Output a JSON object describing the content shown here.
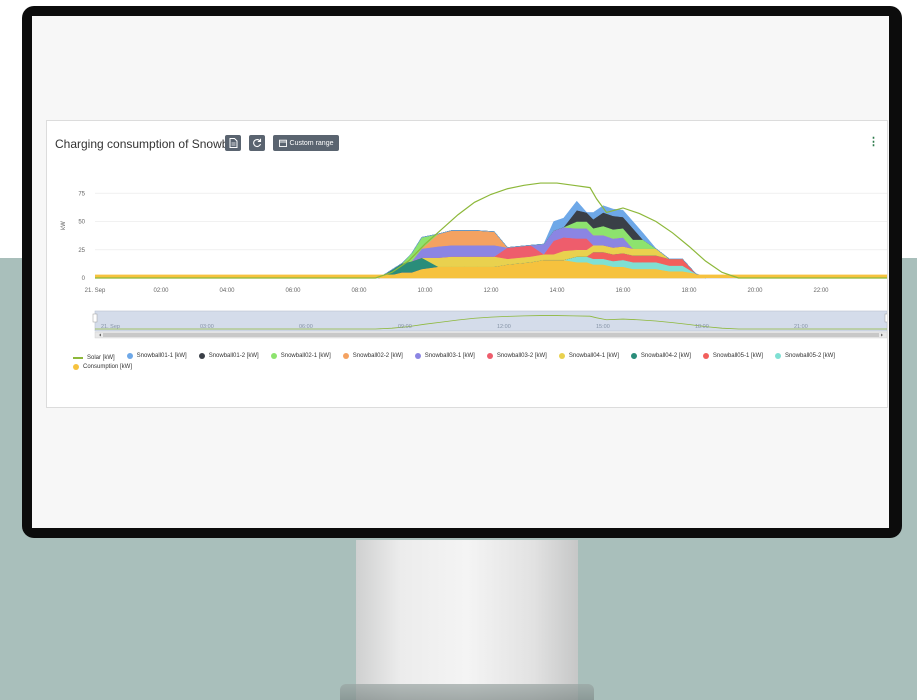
{
  "colors": {
    "solar": "#8db83a",
    "snowball01_1": "#6ea8e8",
    "snowball01_2": "#3a3f47",
    "snowball02_1": "#8de36e",
    "snowball02_2": "#f4a261",
    "snowball03_1": "#8b85e3",
    "snowball03_2": "#ee5d6c",
    "snowball04_1": "#e9d14e",
    "snowball04_2": "#2a8d7a",
    "snowball05_1": "#f25f5c",
    "snowball05_2": "#7fe0d3",
    "consumption": "#f6c23e"
  },
  "card": {
    "title": "Charging consumption of Snowball",
    "export_icon": "file-icon",
    "refresh_icon": "refresh-icon",
    "custom_range_label": "Custom range",
    "calendar_icon": "calendar-icon",
    "menu_icon": "kebab-menu-icon"
  },
  "chart_data": {
    "type": "area",
    "ylabel": "kW",
    "y_ticks": [
      "75",
      "50",
      "25",
      "0"
    ],
    "ylim": [
      0,
      100
    ],
    "x_ticks": [
      "21. Sep",
      "02:00",
      "04:00",
      "06:00",
      "08:00",
      "10:00",
      "12:00",
      "14:00",
      "16:00",
      "18:00",
      "20:00",
      "22:00"
    ],
    "x_hours": [
      0,
      2,
      4,
      6,
      8,
      10,
      12,
      14,
      16,
      18,
      20,
      22
    ],
    "xlim": [
      0,
      24
    ],
    "grid": true,
    "legend_position": "bottom",
    "navigator_ticks": [
      "21. Sep",
      "03:00",
      "06:00",
      "09:00",
      "12:00",
      "15:00",
      "18:00",
      "21:00"
    ],
    "solar": {
      "name": "Solar [kW]",
      "points": [
        [
          0,
          0
        ],
        [
          8.5,
          0
        ],
        [
          9,
          5
        ],
        [
          9.5,
          15
        ],
        [
          10,
          30
        ],
        [
          10.5,
          43
        ],
        [
          11,
          56
        ],
        [
          11.5,
          67
        ],
        [
          12,
          74
        ],
        [
          12.5,
          79
        ],
        [
          13,
          82
        ],
        [
          13.5,
          84
        ],
        [
          14,
          84
        ],
        [
          14.5,
          82
        ],
        [
          15,
          80
        ],
        [
          15.2,
          70
        ],
        [
          15.5,
          58
        ],
        [
          16,
          62
        ],
        [
          16.5,
          57
        ],
        [
          17,
          50
        ],
        [
          17.5,
          40
        ],
        [
          18,
          28
        ],
        [
          18.5,
          15
        ],
        [
          19,
          5
        ],
        [
          19.5,
          0
        ],
        [
          24,
          0
        ]
      ]
    },
    "x": [
      8.6,
      9.3,
      9.6,
      9.9,
      10.4,
      10.8,
      11.2,
      11.6,
      12.1,
      12.5,
      13.2,
      13.6,
      13.9,
      14.2,
      14.6,
      14.9,
      15.1,
      15.4,
      15.7,
      16.0,
      16.3,
      16.6,
      17.0,
      17.4,
      17.8,
      18.2,
      18.5
    ],
    "series": [
      {
        "name": "Consumption [kW]",
        "key": "consumption",
        "values": [
          0,
          5,
          5,
          8,
          10,
          10,
          10,
          10,
          10,
          12,
          14,
          16,
          16,
          16,
          14,
          14,
          12,
          12,
          10,
          10,
          8,
          8,
          8,
          6,
          6,
          4,
          0
        ]
      },
      {
        "name": "Snowball05-2 [kW]",
        "key": "snowball05_2",
        "values": [
          0,
          0,
          0,
          0,
          0,
          0,
          0,
          0,
          0,
          0,
          0,
          0,
          0,
          0,
          5,
          5,
          5,
          5,
          5,
          6,
          6,
          6,
          6,
          5,
          5,
          0,
          0
        ]
      },
      {
        "name": "Snowball05-1 [kW]",
        "key": "snowball05_1",
        "values": [
          0,
          0,
          0,
          0,
          0,
          0,
          0,
          0,
          0,
          0,
          0,
          0,
          0,
          0,
          0,
          0,
          6,
          6,
          6,
          6,
          6,
          6,
          6,
          6,
          6,
          0,
          0
        ]
      },
      {
        "name": "Snowball04-2 [kW]",
        "key": "snowball04_2",
        "values": [
          0,
          8,
          10,
          10,
          0,
          0,
          0,
          0,
          0,
          0,
          0,
          0,
          0,
          0,
          0,
          0,
          0,
          0,
          0,
          0,
          0,
          0,
          0,
          0,
          0,
          0,
          0
        ]
      },
      {
        "name": "Snowball04-1 [kW]",
        "key": "snowball04_1",
        "values": [
          0,
          0,
          0,
          0,
          8,
          9,
          9,
          9,
          9,
          5,
          5,
          5,
          5,
          8,
          6,
          6,
          6,
          6,
          6,
          6,
          6,
          6,
          6,
          0,
          0,
          0,
          0
        ]
      },
      {
        "name": "Snowball03-2 [kW]",
        "key": "snowball03_2",
        "values": [
          0,
          0,
          0,
          0,
          0,
          0,
          0,
          0,
          0,
          10,
          10,
          0,
          12,
          12,
          10,
          10,
          0,
          0,
          0,
          0,
          0,
          0,
          0,
          0,
          0,
          0,
          0
        ]
      },
      {
        "name": "Snowball03-1 [kW]",
        "key": "snowball03_1",
        "values": [
          0,
          0,
          0,
          8,
          10,
          10,
          10,
          10,
          10,
          0,
          0,
          9,
          9,
          9,
          9,
          9,
          9,
          9,
          8,
          8,
          0,
          0,
          0,
          0,
          0,
          0,
          0
        ]
      },
      {
        "name": "Snowball02-2 [kW]",
        "key": "snowball02_2",
        "values": [
          0,
          0,
          0,
          0,
          11,
          13,
          13,
          13,
          12,
          0,
          0,
          0,
          0,
          0,
          0,
          0,
          0,
          0,
          0,
          0,
          0,
          0,
          0,
          0,
          0,
          0,
          0
        ]
      },
      {
        "name": "Snowball02-1 [kW]",
        "key": "snowball02_1",
        "values": [
          0,
          0,
          7,
          10,
          0,
          0,
          0,
          0,
          0,
          0,
          0,
          0,
          0,
          0,
          6,
          6,
          6,
          8,
          8,
          8,
          8,
          8,
          0,
          0,
          0,
          0,
          0
        ]
      },
      {
        "name": "Snowball01-2 [kW]",
        "key": "snowball01_2",
        "values": [
          0,
          0,
          0,
          0,
          0,
          0,
          0,
          0,
          0,
          0,
          0,
          0,
          0,
          0,
          10,
          8,
          8,
          12,
          12,
          10,
          10,
          0,
          0,
          0,
          0,
          0,
          0
        ]
      },
      {
        "name": "Snowball01-1 [kW]",
        "key": "snowball01_1",
        "values": [
          0,
          0,
          0,
          0,
          0,
          0,
          0,
          0,
          0,
          0,
          0,
          0,
          8,
          8,
          8,
          0,
          6,
          6,
          6,
          6,
          6,
          6,
          0,
          0,
          0,
          0,
          0
        ]
      }
    ]
  },
  "legend": [
    {
      "label": "Solar [kW]",
      "key": "solar",
      "shape": "line"
    },
    {
      "label": "Snowball01-1 [kW]",
      "key": "snowball01_1",
      "shape": "dot"
    },
    {
      "label": "Snowball01-2 [kW]",
      "key": "snowball01_2",
      "shape": "dot"
    },
    {
      "label": "Snowball02-1 [kW]",
      "key": "snowball02_1",
      "shape": "dot"
    },
    {
      "label": "Snowball02-2 [kW]",
      "key": "snowball02_2",
      "shape": "dot"
    },
    {
      "label": "Snowball03-1 [kW]",
      "key": "snowball03_1",
      "shape": "dot"
    },
    {
      "label": "Snowball03-2 [kW]",
      "key": "snowball03_2",
      "shape": "dot"
    },
    {
      "label": "Snowball04-1 [kW]",
      "key": "snowball04_1",
      "shape": "dot"
    },
    {
      "label": "Snowball04-2 [kW]",
      "key": "snowball04_2",
      "shape": "dot"
    },
    {
      "label": "Snowball05-1 [kW]",
      "key": "snowball05_1",
      "shape": "dot"
    },
    {
      "label": "Snowball05-2 [kW]",
      "key": "snowball05_2",
      "shape": "dot"
    },
    {
      "label": "Consumption [kW]",
      "key": "consumption",
      "shape": "dot"
    }
  ]
}
